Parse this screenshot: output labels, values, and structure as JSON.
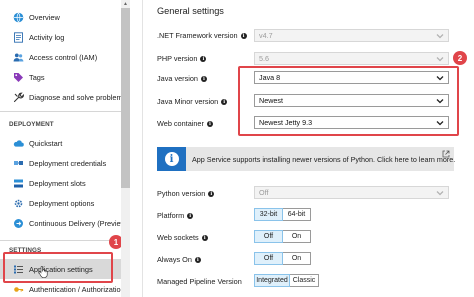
{
  "sidebar": {
    "items_top": [
      {
        "label": "Overview",
        "icon": "globe-icon"
      },
      {
        "label": "Activity log",
        "icon": "activity-log-icon"
      },
      {
        "label": "Access control (IAM)",
        "icon": "people-icon"
      },
      {
        "label": "Tags",
        "icon": "tag-icon"
      },
      {
        "label": "Diagnose and solve problems",
        "icon": "wrench-icon"
      }
    ],
    "deployment_header": "DEPLOYMENT",
    "deployment_items": [
      {
        "label": "Quickstart",
        "icon": "cloud-icon"
      },
      {
        "label": "Deployment credentials",
        "icon": "credentials-icon"
      },
      {
        "label": "Deployment slots",
        "icon": "slots-icon"
      },
      {
        "label": "Deployment options",
        "icon": "options-icon"
      },
      {
        "label": "Continuous Delivery (Preview)",
        "icon": "delivery-icon"
      }
    ],
    "settings_header": "SETTINGS",
    "settings_items": [
      {
        "label": "Application settings",
        "icon": "list-icon",
        "selected": true
      },
      {
        "label": "Authentication / Authorization",
        "icon": "key-icon"
      }
    ]
  },
  "main": {
    "title": "General settings",
    "net_framework": {
      "label": ".NET Framework version",
      "value": "v4.7",
      "disabled": true
    },
    "php": {
      "label": "PHP version",
      "value": "5.6",
      "disabled": true
    },
    "java": {
      "label": "Java version",
      "value": "Java 8"
    },
    "java_minor": {
      "label": "Java Minor version",
      "value": "Newest"
    },
    "web_container": {
      "label": "Web container",
      "value": "Newest Jetty 9.3"
    },
    "banner": {
      "text": "App Service supports installing newer versions of Python. Click here to learn more."
    },
    "python": {
      "label": "Python version",
      "value": "Off",
      "disabled": true
    },
    "platform": {
      "label": "Platform",
      "options": [
        "32-bit",
        "64-bit"
      ],
      "selected": "32-bit"
    },
    "web_sockets": {
      "label": "Web sockets",
      "options": [
        "Off",
        "On"
      ],
      "selected": "Off"
    },
    "always_on": {
      "label": "Always On",
      "options": [
        "Off",
        "On"
      ],
      "selected": "Off"
    },
    "pipeline": {
      "label": "Managed Pipeline Version",
      "options": [
        "Integrated",
        "Classic"
      ],
      "selected": "Integrated"
    }
  },
  "callouts": {
    "one": "1",
    "two": "2"
  },
  "colors": {
    "accent_red": "#e0454a",
    "banner_blue": "#1f70c1",
    "toggle_on": "#dff0fb"
  }
}
